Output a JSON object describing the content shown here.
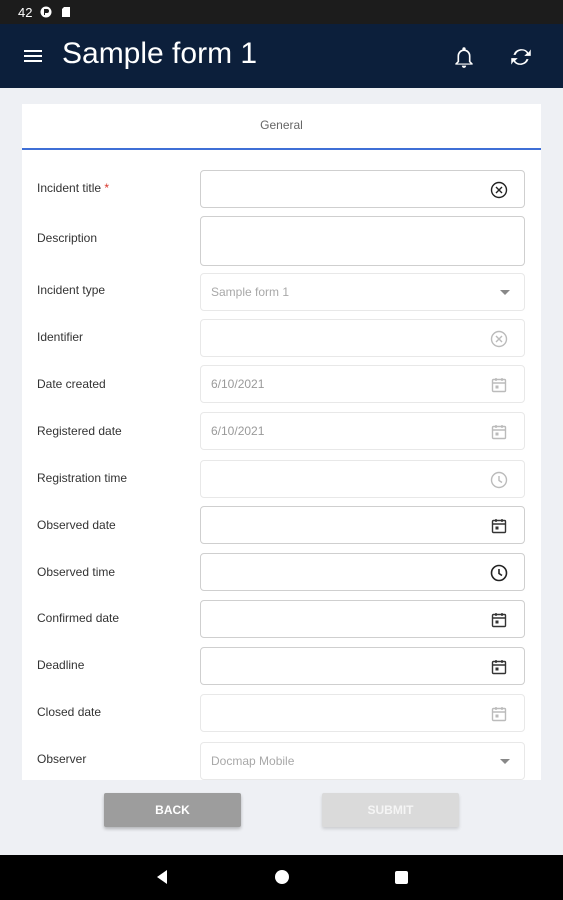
{
  "status_bar": {
    "time": "42"
  },
  "app_bar": {
    "title": "Sample form 1"
  },
  "tabs": [
    {
      "label": "General"
    }
  ],
  "fields": [
    {
      "label": "Incident title",
      "required_mark": "*",
      "value": "",
      "icon": "clear-icon"
    },
    {
      "label": "Description",
      "value": ""
    },
    {
      "label": "Incident type",
      "value": "Sample form 1",
      "icon": "dropdown-caret-icon"
    },
    {
      "label": "Identifier",
      "value": "",
      "icon": "clear-icon"
    },
    {
      "label": "Date created",
      "value": "6/10/2021",
      "icon": "calendar-icon"
    },
    {
      "label": "Registered date",
      "value": "6/10/2021",
      "icon": "calendar-icon"
    },
    {
      "label": "Registration time",
      "value": "",
      "icon": "clock-icon"
    },
    {
      "label": "Observed date",
      "value": "",
      "icon": "calendar-icon"
    },
    {
      "label": "Observed time",
      "value": "",
      "icon": "clock-icon"
    },
    {
      "label": "Confirmed date",
      "value": "",
      "icon": "calendar-icon"
    },
    {
      "label": "Deadline",
      "value": "",
      "icon": "calendar-icon"
    },
    {
      "label": "Closed date",
      "value": "",
      "icon": "calendar-icon"
    },
    {
      "label": "Observer",
      "value": "Docmap Mobile",
      "icon": "dropdown-caret-icon"
    }
  ],
  "buttons": {
    "back": "BACK",
    "submit": "SUBMIT"
  },
  "colors": {
    "app_bar": "#0c1f3b",
    "tab_indicator": "#3f6fd6",
    "required": "#d9352b"
  }
}
